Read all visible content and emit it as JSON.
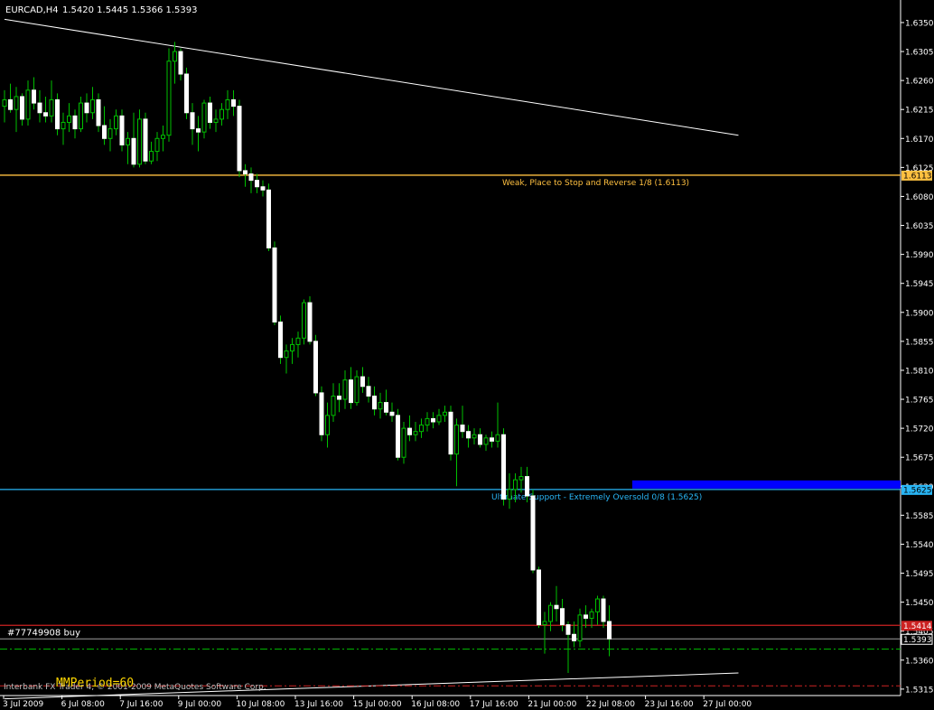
{
  "header": {
    "symbol": "EURCAD,H4",
    "ohlc": "1.5420 1.5445 1.5366 1.5393"
  },
  "lines": [
    {
      "price": 1.6113,
      "color": "#ffc040",
      "label": "Weak, Place to Stop and Reverse  1/8  (1.6113)",
      "tag": "1.6113",
      "name": "weak-stop-reverse-line"
    },
    {
      "price": 1.5625,
      "color": "#29b6f6",
      "label": "Ultimate Support - Extremely Oversold  0/8  (1.5625)",
      "tag": "1.5625",
      "name": "ultimate-support-line"
    },
    {
      "price": 1.5414,
      "color": "#cc2222",
      "label": "",
      "tag": "1.5414",
      "name": "red-level-line"
    }
  ],
  "current_price": {
    "price": 1.5393,
    "tag": "1.5393"
  },
  "order": {
    "label": "#77749908 buy",
    "price": 1.5393
  },
  "green_dashed_price": 1.5377,
  "red_dashed_price": 1.532,
  "footer": {
    "indicator_label": "MMPeriod=60",
    "copyright": "Interbank FX Trader 4, © 2001-2009 MetaQuotes Software Corp."
  },
  "colors": {
    "background": "#000000",
    "bull_candle": "#000000",
    "bear_candle": "#ffffff",
    "wick": "#00c000",
    "trendline": "#ffffff",
    "blue_block": "#0000ff",
    "indicator_text": "#ffd700",
    "axis_text": "#ffffff"
  },
  "chart_data": {
    "type": "candlestick",
    "title": "EURCAD,H4",
    "ylim": [
      1.5305,
      1.6385
    ],
    "y_ticks": [
      1.635,
      1.6305,
      1.626,
      1.6215,
      1.617,
      1.6125,
      1.608,
      1.6035,
      1.599,
      1.5945,
      1.59,
      1.5855,
      1.581,
      1.5765,
      1.572,
      1.5675,
      1.563,
      1.5585,
      1.554,
      1.5495,
      1.545,
      1.5405,
      1.536,
      1.5315
    ],
    "x_labels": [
      "3 Jul 2009",
      "6 Jul 08:00",
      "7 Jul 16:00",
      "9 Jul 00:00",
      "10 Jul 08:00",
      "13 Jul 16:00",
      "15 Jul 00:00",
      "16 Jul 08:00",
      "17 Jul 16:00",
      "21 Jul 00:00",
      "22 Jul 08:00",
      "23 Jul 16:00",
      "27 Jul 00:00"
    ],
    "candles": [
      {
        "o": 1.622,
        "h": 1.6245,
        "l": 1.6195,
        "c": 1.623
      },
      {
        "o": 1.623,
        "h": 1.6255,
        "l": 1.621,
        "c": 1.6215
      },
      {
        "o": 1.6215,
        "h": 1.625,
        "l": 1.618,
        "c": 1.6235
      },
      {
        "o": 1.6235,
        "h": 1.624,
        "l": 1.619,
        "c": 1.62
      },
      {
        "o": 1.62,
        "h": 1.626,
        "l": 1.619,
        "c": 1.6245
      },
      {
        "o": 1.6245,
        "h": 1.6265,
        "l": 1.6215,
        "c": 1.6225
      },
      {
        "o": 1.6225,
        "h": 1.6245,
        "l": 1.6195,
        "c": 1.621
      },
      {
        "o": 1.621,
        "h": 1.6235,
        "l": 1.6195,
        "c": 1.6205
      },
      {
        "o": 1.6205,
        "h": 1.626,
        "l": 1.6195,
        "c": 1.623
      },
      {
        "o": 1.623,
        "h": 1.624,
        "l": 1.6175,
        "c": 1.6185
      },
      {
        "o": 1.6185,
        "h": 1.621,
        "l": 1.616,
        "c": 1.6195
      },
      {
        "o": 1.6195,
        "h": 1.6225,
        "l": 1.618,
        "c": 1.6205
      },
      {
        "o": 1.6205,
        "h": 1.6215,
        "l": 1.617,
        "c": 1.6185
      },
      {
        "o": 1.6185,
        "h": 1.6235,
        "l": 1.618,
        "c": 1.6225
      },
      {
        "o": 1.6225,
        "h": 1.624,
        "l": 1.6195,
        "c": 1.621
      },
      {
        "o": 1.621,
        "h": 1.625,
        "l": 1.62,
        "c": 1.623
      },
      {
        "o": 1.623,
        "h": 1.624,
        "l": 1.618,
        "c": 1.619
      },
      {
        "o": 1.619,
        "h": 1.622,
        "l": 1.616,
        "c": 1.617
      },
      {
        "o": 1.617,
        "h": 1.62,
        "l": 1.615,
        "c": 1.6185
      },
      {
        "o": 1.6185,
        "h": 1.6215,
        "l": 1.6175,
        "c": 1.6205
      },
      {
        "o": 1.6205,
        "h": 1.6215,
        "l": 1.615,
        "c": 1.616
      },
      {
        "o": 1.616,
        "h": 1.618,
        "l": 1.613,
        "c": 1.617
      },
      {
        "o": 1.617,
        "h": 1.621,
        "l": 1.6125,
        "c": 1.613
      },
      {
        "o": 1.613,
        "h": 1.6215,
        "l": 1.6125,
        "c": 1.62
      },
      {
        "o": 1.62,
        "h": 1.621,
        "l": 1.613,
        "c": 1.6135
      },
      {
        "o": 1.6135,
        "h": 1.6165,
        "l": 1.613,
        "c": 1.615
      },
      {
        "o": 1.615,
        "h": 1.618,
        "l": 1.6135,
        "c": 1.617
      },
      {
        "o": 1.617,
        "h": 1.619,
        "l": 1.615,
        "c": 1.6175
      },
      {
        "o": 1.6175,
        "h": 1.631,
        "l": 1.6165,
        "c": 1.629
      },
      {
        "o": 1.629,
        "h": 1.632,
        "l": 1.6255,
        "c": 1.6305
      },
      {
        "o": 1.6305,
        "h": 1.631,
        "l": 1.626,
        "c": 1.627
      },
      {
        "o": 1.627,
        "h": 1.628,
        "l": 1.62,
        "c": 1.621
      },
      {
        "o": 1.621,
        "h": 1.6225,
        "l": 1.616,
        "c": 1.6185
      },
      {
        "o": 1.6185,
        "h": 1.6205,
        "l": 1.615,
        "c": 1.618
      },
      {
        "o": 1.618,
        "h": 1.623,
        "l": 1.617,
        "c": 1.6225
      },
      {
        "o": 1.6225,
        "h": 1.6235,
        "l": 1.6185,
        "c": 1.6195
      },
      {
        "o": 1.6195,
        "h": 1.6215,
        "l": 1.618,
        "c": 1.62
      },
      {
        "o": 1.62,
        "h": 1.6225,
        "l": 1.619,
        "c": 1.6215
      },
      {
        "o": 1.6215,
        "h": 1.6245,
        "l": 1.62,
        "c": 1.623
      },
      {
        "o": 1.623,
        "h": 1.6245,
        "l": 1.6205,
        "c": 1.622
      },
      {
        "o": 1.622,
        "h": 1.623,
        "l": 1.611,
        "c": 1.612
      },
      {
        "o": 1.612,
        "h": 1.613,
        "l": 1.6095,
        "c": 1.6115
      },
      {
        "o": 1.6115,
        "h": 1.6125,
        "l": 1.6085,
        "c": 1.6105
      },
      {
        "o": 1.6105,
        "h": 1.6115,
        "l": 1.6085,
        "c": 1.6095
      },
      {
        "o": 1.6095,
        "h": 1.6105,
        "l": 1.608,
        "c": 1.609
      },
      {
        "o": 1.609,
        "h": 1.61,
        "l": 1.5995,
        "c": 1.6
      },
      {
        "o": 1.6,
        "h": 1.601,
        "l": 1.588,
        "c": 1.5885
      },
      {
        "o": 1.5885,
        "h": 1.5895,
        "l": 1.582,
        "c": 1.583
      },
      {
        "o": 1.583,
        "h": 1.585,
        "l": 1.5805,
        "c": 1.584
      },
      {
        "o": 1.584,
        "h": 1.586,
        "l": 1.582,
        "c": 1.585
      },
      {
        "o": 1.585,
        "h": 1.587,
        "l": 1.583,
        "c": 1.586
      },
      {
        "o": 1.586,
        "h": 1.592,
        "l": 1.585,
        "c": 1.5915
      },
      {
        "o": 1.5915,
        "h": 1.5925,
        "l": 1.585,
        "c": 1.5855
      },
      {
        "o": 1.5855,
        "h": 1.5865,
        "l": 1.577,
        "c": 1.5775
      },
      {
        "o": 1.5775,
        "h": 1.5785,
        "l": 1.57,
        "c": 1.571
      },
      {
        "o": 1.571,
        "h": 1.576,
        "l": 1.569,
        "c": 1.574
      },
      {
        "o": 1.574,
        "h": 1.579,
        "l": 1.573,
        "c": 1.577
      },
      {
        "o": 1.577,
        "h": 1.579,
        "l": 1.5745,
        "c": 1.5765
      },
      {
        "o": 1.5765,
        "h": 1.581,
        "l": 1.575,
        "c": 1.5795
      },
      {
        "o": 1.5795,
        "h": 1.5815,
        "l": 1.575,
        "c": 1.576
      },
      {
        "o": 1.576,
        "h": 1.581,
        "l": 1.5755,
        "c": 1.58
      },
      {
        "o": 1.58,
        "h": 1.5815,
        "l": 1.5775,
        "c": 1.5785
      },
      {
        "o": 1.5785,
        "h": 1.58,
        "l": 1.576,
        "c": 1.577
      },
      {
        "o": 1.577,
        "h": 1.5785,
        "l": 1.574,
        "c": 1.575
      },
      {
        "o": 1.575,
        "h": 1.5775,
        "l": 1.5735,
        "c": 1.576
      },
      {
        "o": 1.576,
        "h": 1.578,
        "l": 1.574,
        "c": 1.5745
      },
      {
        "o": 1.5745,
        "h": 1.576,
        "l": 1.573,
        "c": 1.574
      },
      {
        "o": 1.574,
        "h": 1.575,
        "l": 1.567,
        "c": 1.5675
      },
      {
        "o": 1.5675,
        "h": 1.573,
        "l": 1.5665,
        "c": 1.572
      },
      {
        "o": 1.572,
        "h": 1.574,
        "l": 1.57,
        "c": 1.571
      },
      {
        "o": 1.571,
        "h": 1.573,
        "l": 1.57,
        "c": 1.5715
      },
      {
        "o": 1.5715,
        "h": 1.5735,
        "l": 1.5705,
        "c": 1.5725
      },
      {
        "o": 1.5725,
        "h": 1.5745,
        "l": 1.5715,
        "c": 1.5735
      },
      {
        "o": 1.5735,
        "h": 1.5745,
        "l": 1.572,
        "c": 1.573
      },
      {
        "o": 1.573,
        "h": 1.575,
        "l": 1.5725,
        "c": 1.574
      },
      {
        "o": 1.574,
        "h": 1.5755,
        "l": 1.573,
        "c": 1.5745
      },
      {
        "o": 1.5745,
        "h": 1.5755,
        "l": 1.567,
        "c": 1.568
      },
      {
        "o": 1.568,
        "h": 1.5735,
        "l": 1.563,
        "c": 1.5725
      },
      {
        "o": 1.5725,
        "h": 1.5755,
        "l": 1.5705,
        "c": 1.5715
      },
      {
        "o": 1.5715,
        "h": 1.5725,
        "l": 1.569,
        "c": 1.5705
      },
      {
        "o": 1.5705,
        "h": 1.572,
        "l": 1.5695,
        "c": 1.571
      },
      {
        "o": 1.571,
        "h": 1.572,
        "l": 1.569,
        "c": 1.5695
      },
      {
        "o": 1.5695,
        "h": 1.571,
        "l": 1.5685,
        "c": 1.5705
      },
      {
        "o": 1.5705,
        "h": 1.5715,
        "l": 1.569,
        "c": 1.57
      },
      {
        "o": 1.57,
        "h": 1.576,
        "l": 1.569,
        "c": 1.571
      },
      {
        "o": 1.571,
        "h": 1.572,
        "l": 1.56,
        "c": 1.561
      },
      {
        "o": 1.561,
        "h": 1.565,
        "l": 1.5595,
        "c": 1.5625
      },
      {
        "o": 1.5625,
        "h": 1.565,
        "l": 1.5605,
        "c": 1.564
      },
      {
        "o": 1.564,
        "h": 1.566,
        "l": 1.562,
        "c": 1.5645
      },
      {
        "o": 1.5645,
        "h": 1.566,
        "l": 1.5605,
        "c": 1.5615
      },
      {
        "o": 1.5615,
        "h": 1.5625,
        "l": 1.5495,
        "c": 1.55
      },
      {
        "o": 1.55,
        "h": 1.5505,
        "l": 1.541,
        "c": 1.5415
      },
      {
        "o": 1.5415,
        "h": 1.5435,
        "l": 1.537,
        "c": 1.542
      },
      {
        "o": 1.542,
        "h": 1.545,
        "l": 1.5405,
        "c": 1.5445
      },
      {
        "o": 1.5445,
        "h": 1.5475,
        "l": 1.542,
        "c": 1.544
      },
      {
        "o": 1.544,
        "h": 1.5455,
        "l": 1.5405,
        "c": 1.5415
      },
      {
        "o": 1.5415,
        "h": 1.542,
        "l": 1.534,
        "c": 1.54
      },
      {
        "o": 1.54,
        "h": 1.542,
        "l": 1.538,
        "c": 1.539
      },
      {
        "o": 1.539,
        "h": 1.544,
        "l": 1.538,
        "c": 1.543
      },
      {
        "o": 1.543,
        "h": 1.5445,
        "l": 1.541,
        "c": 1.5425
      },
      {
        "o": 1.5425,
        "h": 1.544,
        "l": 1.541,
        "c": 1.5435
      },
      {
        "o": 1.5435,
        "h": 1.546,
        "l": 1.5415,
        "c": 1.5455
      },
      {
        "o": 1.5455,
        "h": 1.546,
        "l": 1.541,
        "c": 1.542
      },
      {
        "o": 1.542,
        "h": 1.5445,
        "l": 1.5366,
        "c": 1.5393
      }
    ],
    "trendlines": [
      {
        "name": "descending-trendline",
        "from": {
          "index": 0,
          "price": 1.6355
        },
        "to": {
          "index": 125,
          "price": 1.6175
        }
      },
      {
        "name": "ascending-trendline",
        "from": {
          "index": 0,
          "price": 1.53
        },
        "to": {
          "index": 125,
          "price": 1.534
        }
      }
    ]
  }
}
